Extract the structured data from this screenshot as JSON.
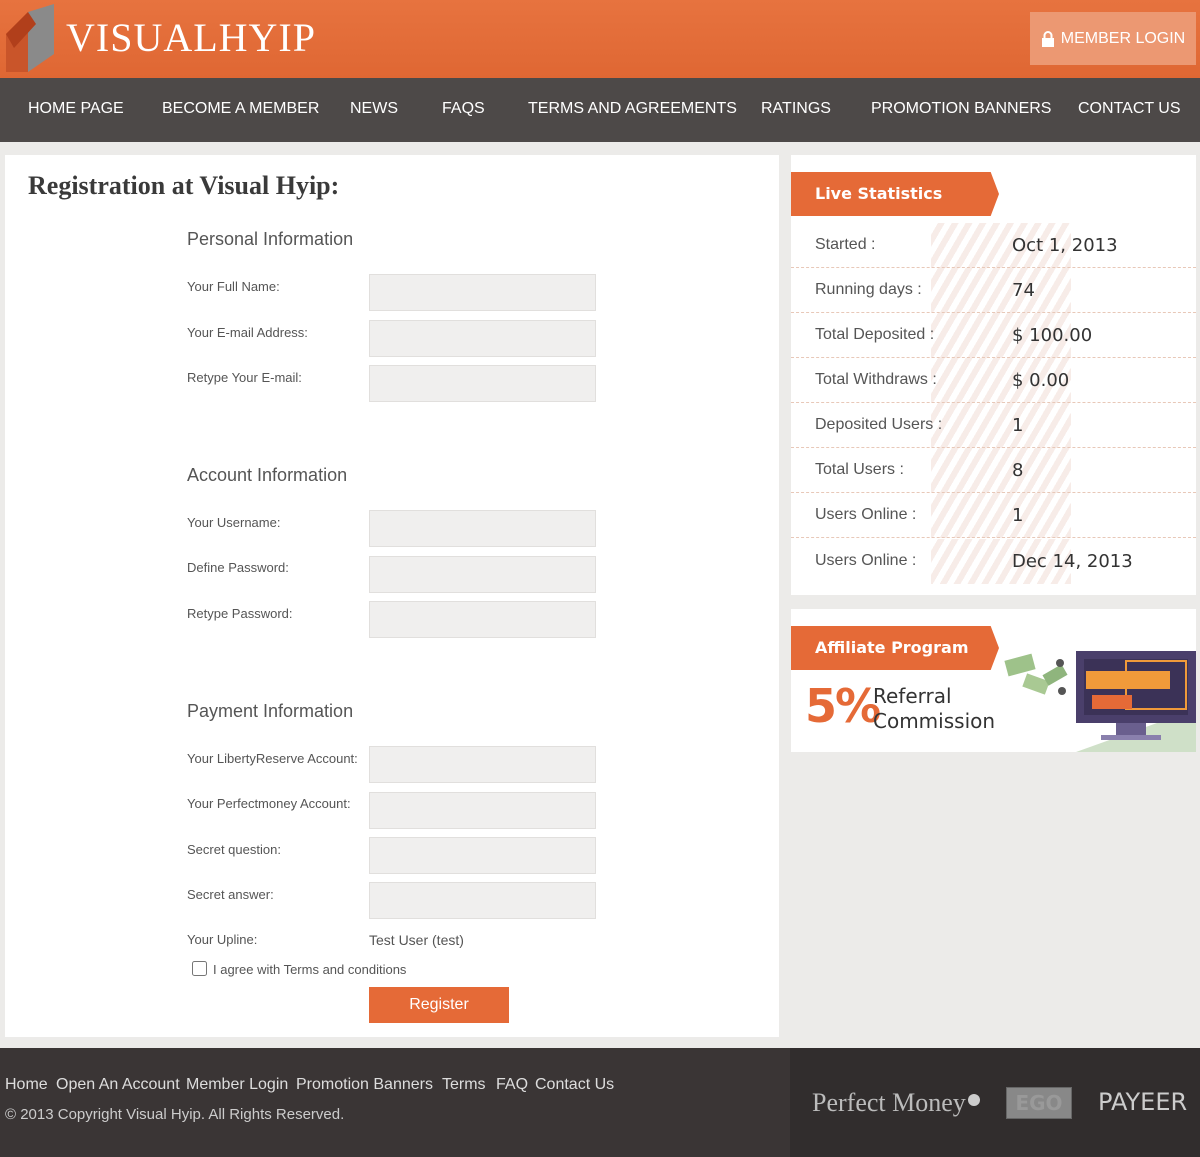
{
  "header": {
    "logo_text": "VISUALHYIP",
    "member_login_label": "MEMBER LOGIN",
    "accent_color": "#e56a37"
  },
  "nav": {
    "items": [
      {
        "label": "HOME PAGE"
      },
      {
        "label": "BECOME A MEMBER"
      },
      {
        "label": "NEWS"
      },
      {
        "label": "FAQS"
      },
      {
        "label": "TERMS AND AGREEMENTS"
      },
      {
        "label": "RATINGS"
      },
      {
        "label": "PROMOTION BANNERS"
      },
      {
        "label": "CONTACT US"
      }
    ]
  },
  "form": {
    "title": "Registration at Visual Hyip:",
    "personal": {
      "heading": "Personal Information",
      "full_name_label": "Your Full Name:",
      "email_label": "Your E-mail Address:",
      "retype_email_label": "Retype Your E-mail:"
    },
    "account": {
      "heading": "Account Information",
      "username_label": "Your Username:",
      "password_label": "Define Password:",
      "retype_password_label": "Retype Password:"
    },
    "payment": {
      "heading": "Payment Information",
      "libertyreserve_label": "Your LibertyReserve Account:",
      "perfectmoney_label": "Your Perfectmoney Account:",
      "secret_question_label": "Secret question:",
      "secret_answer_label": "Secret answer:"
    },
    "upline_label": "Your Upline:",
    "upline_value": "Test User (test)",
    "agree_label": "I agree with Terms and conditions",
    "register_label": "Register"
  },
  "stats": {
    "heading": "Live Statistics",
    "rows": [
      {
        "label": "Started :",
        "value": "Oct 1, 2013"
      },
      {
        "label": "Running days :",
        "value": "74"
      },
      {
        "label": "Total Deposited :",
        "value": "$ 100.00"
      },
      {
        "label": "Total Withdraws :",
        "value": "$ 0.00"
      },
      {
        "label": "Deposited Users :",
        "value": "1"
      },
      {
        "label": "Total Users :",
        "value": "8"
      },
      {
        "label": "Users Online :",
        "value": "1"
      },
      {
        "label": "Users Online :",
        "value": "Dec 14, 2013"
      }
    ]
  },
  "affiliate": {
    "heading": "Affiliate Program",
    "percent": "5%",
    "line1": "Referral",
    "line2": "Commission"
  },
  "footer": {
    "links": [
      {
        "label": "Home"
      },
      {
        "label": "Open An Account"
      },
      {
        "label": "Member Login"
      },
      {
        "label": "Promotion Banners"
      },
      {
        "label": "Terms"
      },
      {
        "label": "FAQ"
      },
      {
        "label": "Contact Us"
      }
    ],
    "copyright": "© 2013 Copyright Visual Hyip. All Rights Reserved.",
    "payment_logos": {
      "perfect_money": "Perfect Money",
      "ego": "EGO",
      "payeer": "PAYEER"
    }
  }
}
